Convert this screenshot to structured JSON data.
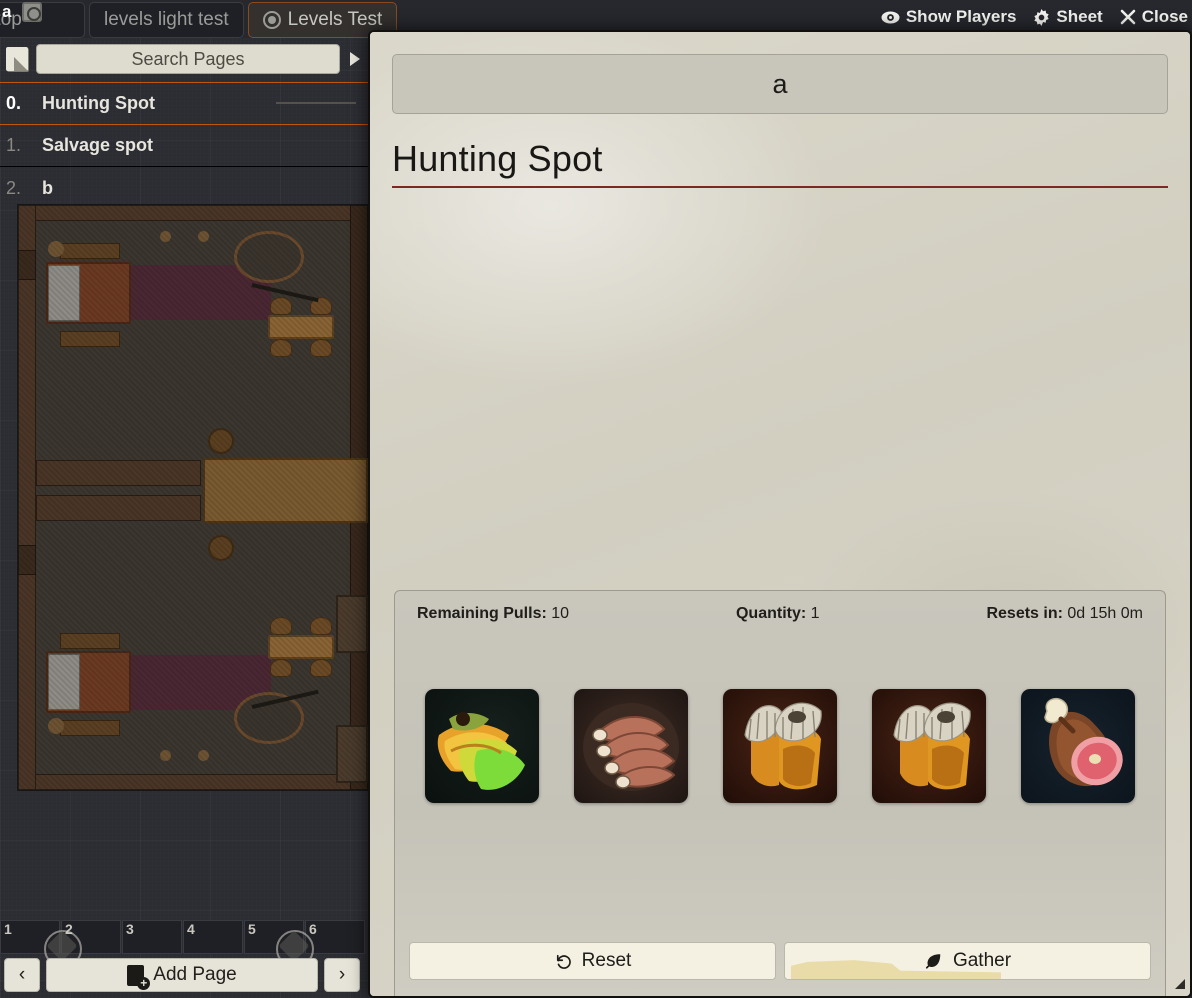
{
  "scene_tabs": [
    {
      "label": "a",
      "icon": "map-icon",
      "type": "corner-badge"
    },
    {
      "label": "bletop",
      "icon": "map-icon",
      "active": false
    },
    {
      "label": "levels light test",
      "icon": "",
      "active": false
    },
    {
      "label": "Levels Test",
      "icon": "target-icon",
      "active": true
    }
  ],
  "top_right_controls": [
    {
      "label": "Show Players",
      "icon": "eye-icon"
    },
    {
      "label": "Sheet",
      "icon": "gear-icon"
    },
    {
      "label": "Close",
      "icon": "close-icon"
    }
  ],
  "sidebar": {
    "note_icon": "journal-page-icon",
    "search": {
      "placeholder": "Search Pages",
      "value": ""
    },
    "collapse_icon": "triangle-right-icon",
    "pages": [
      {
        "num": "0.",
        "label": "Hunting Spot",
        "active": true
      },
      {
        "num": "1.",
        "label": "Salvage spot",
        "active": false
      },
      {
        "num": "2.",
        "label": "b",
        "active": false
      }
    ],
    "footer": {
      "prev_label": "‹",
      "next_label": "›",
      "add_page_label": "Add Page",
      "add_page_icon": "page-plus-icon"
    },
    "hotbar_slots": [
      "1",
      "2",
      "3",
      "4",
      "5",
      "6"
    ]
  },
  "journal": {
    "title_value": "a",
    "title_placeholder": "",
    "page_heading": "Hunting Spot",
    "body_text": "",
    "loot": {
      "stats": {
        "remaining_pulls_label": "Remaining Pulls:",
        "remaining_pulls_value": "10",
        "quantity_label": "Quantity:",
        "quantity_value": "1",
        "resets_label": "Resets in:",
        "resets_value": "0d 15h 0m"
      },
      "items": [
        {
          "name": "bananas",
          "art": "art-banana"
        },
        {
          "name": "ribs",
          "art": "art-ribs"
        },
        {
          "name": "corn-husk",
          "art": "art-corn"
        },
        {
          "name": "corn-husk",
          "art": "art-corn"
        },
        {
          "name": "ham",
          "art": "art-ham"
        }
      ],
      "buttons": [
        {
          "label": "Reset",
          "icon": "undo-icon"
        },
        {
          "label": "Gather",
          "icon": "leaf-icon"
        }
      ]
    }
  },
  "colors": {
    "accent_orange": "#c1540e",
    "heading_rule": "#7d2822",
    "parchment": "#d8d5c8",
    "panel_gray": "#c5c3b8",
    "button_cream": "#f4f1e2",
    "gather_fill": "#eadca8"
  }
}
